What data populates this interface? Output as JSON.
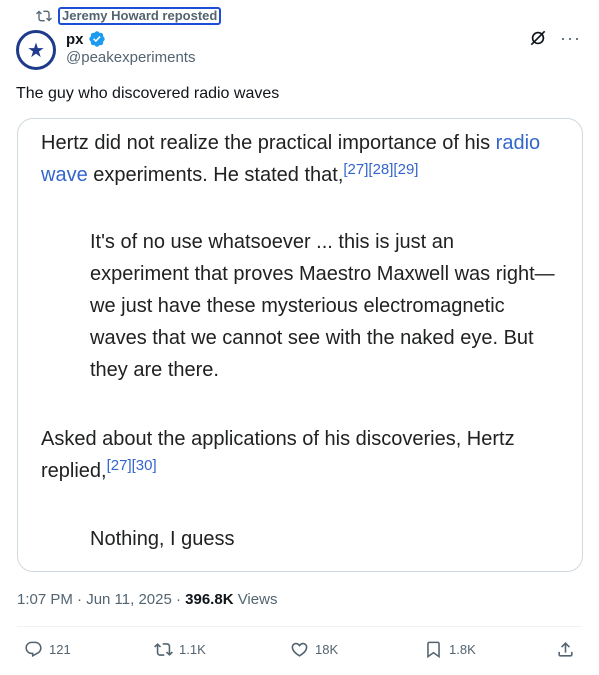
{
  "repost": {
    "label": "Jeremy Howard reposted"
  },
  "author": {
    "name": "px",
    "handle": "@peakexperiments"
  },
  "tweet": {
    "text": "The guy who discovered radio waves"
  },
  "media": {
    "p1_before": "Hertz did not realize the practical importance of his ",
    "p1_link": "radio wave",
    "p1_after": " experiments. He stated that,",
    "p1_refs": "[27][28][29]",
    "quote1": "It's of no use whatsoever ... this is just an experiment that proves Maestro Maxwell was right—we just have these mysterious electromagnetic waves that we cannot see with the naked eye. But they are there.",
    "p2_text": "Asked about the applications of his discoveries, Hertz replied,",
    "p2_refs": "[27][30]",
    "quote2": "Nothing, I guess"
  },
  "meta": {
    "time": "1:07 PM · Jun 11, 2025 · ",
    "views_count": "396.8K",
    "views_label": " Views"
  },
  "actions": {
    "replies": "121",
    "reposts": "1.1K",
    "likes": "18K",
    "bookmarks": "1.8K"
  },
  "icons": {
    "grok": "grok-icon",
    "more": "more-icon",
    "verified_color": "#1d9bf0",
    "accent": "#1d9bf0"
  }
}
